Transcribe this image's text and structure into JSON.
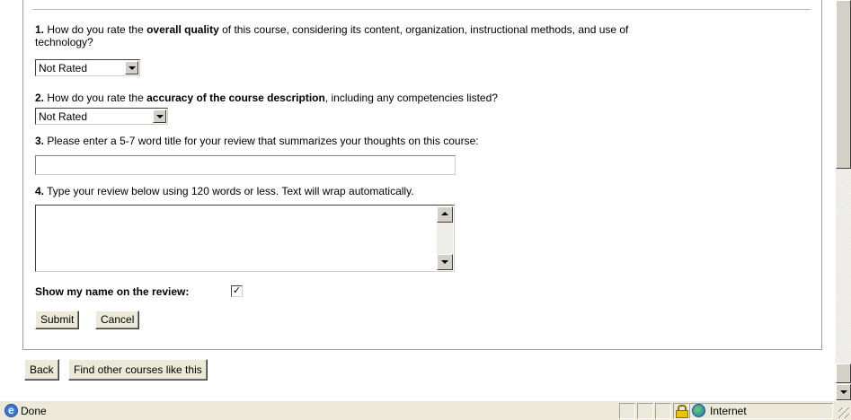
{
  "questions": {
    "q1": {
      "num": "1.",
      "pre": " How do you rate the ",
      "bold": "overall quality",
      "post": " of this course, considering its content, organization, instructional methods, and use of",
      "post2": "technology?",
      "select_value": "Not Rated"
    },
    "q2": {
      "num": "2.",
      "pre": " How do you rate the ",
      "bold": "accuracy of the course description",
      "post": ", including any competencies listed?",
      "select_value": "Not Rated"
    },
    "q3": {
      "num": "3.",
      "text": " Please enter a 5-7 word title for your review that summarizes your thoughts on this course:",
      "input_value": ""
    },
    "q4": {
      "num": "4.",
      "text": " Type your review below using 120 words or less. Text will wrap automatically.",
      "textarea_value": ""
    }
  },
  "show_name": {
    "label": "Show my name on the review:",
    "checked": true,
    "check_glyph": "✓"
  },
  "buttons": {
    "submit": "Submit",
    "cancel": "Cancel",
    "back": "Back",
    "find_other": "Find other courses like this"
  },
  "statusbar": {
    "status": "Done",
    "zone": "Internet"
  },
  "icons": {
    "browser": "ie-page-icon",
    "lock": "lock-icon",
    "zone": "globe-icon"
  }
}
